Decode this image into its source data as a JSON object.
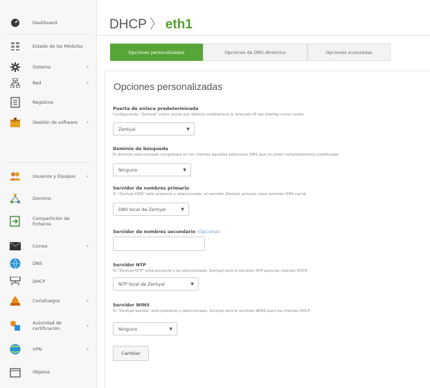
{
  "sidebar": {
    "items": [
      {
        "label": "Dashboard",
        "icon": "dashboard-icon",
        "arrow": ""
      },
      {
        "label": "Estado de los Módulos",
        "icon": "modules-icon",
        "arrow": ""
      },
      {
        "label": "Sistema",
        "icon": "gear-icon",
        "arrow": "‹"
      },
      {
        "label": "Red",
        "icon": "network-icon",
        "arrow": "‹"
      },
      {
        "label": "Registros",
        "icon": "logs-icon",
        "arrow": ""
      },
      {
        "label": "Gestión de software",
        "icon": "software-package-icon",
        "arrow": "‹"
      },
      {
        "label": "Usuarios y Equipos",
        "icon": "users-icon",
        "arrow": "‹"
      },
      {
        "label": "Dominio",
        "icon": "domain-icon",
        "arrow": ""
      },
      {
        "label": "Compartición de Ficheros",
        "icon": "file-sharing-icon",
        "arrow": ""
      },
      {
        "label": "Correo",
        "icon": "mail-icon",
        "arrow": "‹"
      },
      {
        "label": "DNS",
        "icon": "dns-icon",
        "arrow": ""
      },
      {
        "label": "DHCP",
        "icon": "dhcp-icon",
        "arrow": ""
      },
      {
        "label": "Cortafuegos",
        "icon": "firewall-icon",
        "arrow": "‹"
      },
      {
        "label": "Autoridad de certificación",
        "icon": "certificate-icon",
        "arrow": "‹"
      },
      {
        "label": "VPN",
        "icon": "vpn-icon",
        "arrow": "‹"
      },
      {
        "label": "Objetos",
        "icon": "objects-icon",
        "arrow": ""
      }
    ]
  },
  "header": {
    "section": "DHCP",
    "separator": "〉",
    "interface": "eth1"
  },
  "tabs": [
    {
      "label": "Opciones personalizadas",
      "active": true
    },
    {
      "label": "Opciones de DNS dinámico",
      "active": false
    },
    {
      "label": "Opciones avanzadas",
      "active": false
    }
  ],
  "form": {
    "title": "Opciones personalizadas",
    "gateway": {
      "label": "Puerta de enlace predeterminada",
      "help": "Configurando \"Zentyal\" como router por defecto establecerá la dirección IP del interfaz como router",
      "value": "Zentyal"
    },
    "search_domain": {
      "label": "Dominio de búsqueda",
      "help": "El dominio seleccionado completará en los clientes aquellos peticiones DNS que no estén completamente cualificadas",
      "value": "Ninguno"
    },
    "primary_ns": {
      "label": "Servidor de nombres primario",
      "help": "Si \"Zentyal DNS\" está presente y seleccionado, el servidor Zentyal actuará como servidor DNS caché",
      "value": "DNS local de Zentyal"
    },
    "secondary_ns": {
      "label": "Servidor de nombres secundario",
      "optional": "(Opcional)",
      "value": ""
    },
    "ntp": {
      "label": "Servidor NTP",
      "help": "Si \"Zentyal NTP\" está presente y es seleccionado, Zentyal será el servidor NTP para los clientes DHCP",
      "value": "NTP local de Zentyal"
    },
    "wins": {
      "label": "Servidor WINS",
      "help": "Si \"Zentyal Samba\" está presente y seleccionado, Zentyal será el servidor WINS para los clientes DHCP",
      "value": "Ninguno"
    },
    "submit_label": "Cambiar"
  },
  "colors": {
    "accent": "#57a537",
    "title_accent": "#53a12b",
    "optional": "#6aa0c8"
  }
}
